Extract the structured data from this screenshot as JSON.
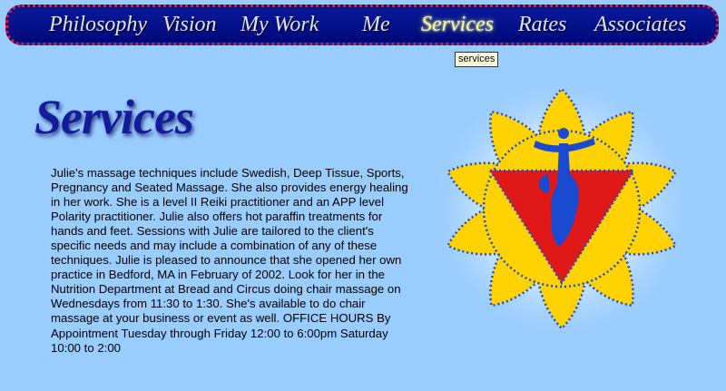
{
  "nav": {
    "items": [
      {
        "label": "Philosophy"
      },
      {
        "label": "Vision"
      },
      {
        "label": "My Work"
      },
      {
        "label": "Me"
      },
      {
        "label": "Services"
      },
      {
        "label": "Rates"
      },
      {
        "label": "Associates"
      }
    ],
    "active": "Services",
    "tooltip": "services"
  },
  "page": {
    "title": "Services",
    "body": "Julie's massage techniques include Swedish, Deep Tissue, Sports, Pregnancy and Seated Massage. She also provides energy healing in her work. She is a level II Reiki practitioner and an APP level Polarity practitioner. Julie also offers hot paraffin treatments for hands and feet. Sessions with Julie are tailored to the client's specific needs and may include a combination of any of these techniques. Julie is pleased to announce that she opened her own practice in Bedford, MA in February of 2002. Look for her in the Nutrition Department at Bread and Circus doing chair massage on Wednesdays from 11:30 to 1:30. She's available to do chair massage at your business or event as well. OFFICE HOURS By Appointment Tuesday through Friday 12:00 to 6:00pm Saturday 10:00 to 2:00"
  },
  "image": {
    "icon": "solar-plexus-chakra-icon"
  },
  "colors": {
    "background": "#99ccff",
    "nav_background": "#0a1280",
    "nav_border": "#e8183a",
    "title": "#141c9c",
    "petal": "#ffd200",
    "triangle": "#e01818",
    "symbol": "#1a4ad0"
  }
}
